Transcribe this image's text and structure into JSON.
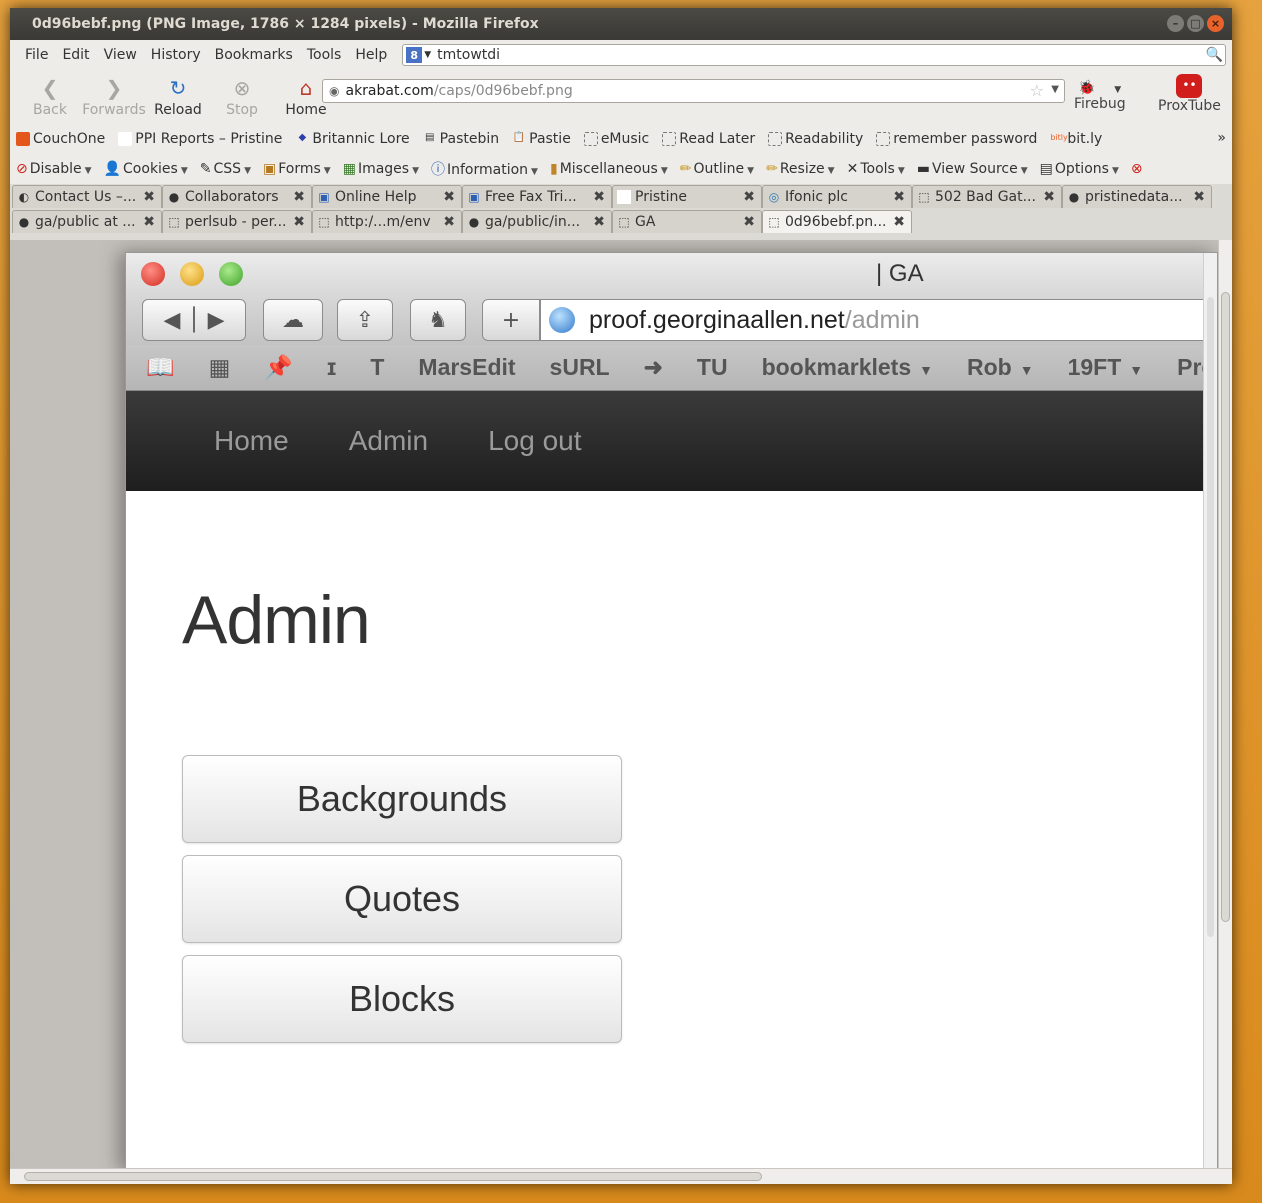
{
  "window": {
    "title": "0d96bebf.png (PNG Image, 1786 × 1284 pixels) - Mozilla Firefox"
  },
  "menu": [
    "File",
    "Edit",
    "View",
    "History",
    "Bookmarks",
    "Tools",
    "Help"
  ],
  "search": {
    "value": "tmtowtdi"
  },
  "nav": {
    "back": "Back",
    "forwards": "Forwards",
    "reload": "Reload",
    "stop": "Stop",
    "home": "Home",
    "url_host": "akrabat.com",
    "url_path": "/caps/0d96bebf.png",
    "firebug": "Firebug",
    "proxtube": "ProxTube"
  },
  "bookmarks": [
    "CouchOne",
    "PPI Reports – Pristine",
    "Britannic Lore",
    "Pastebin",
    "Pastie",
    "eMusic",
    "Read Later",
    "Readability",
    "remember password",
    "bit.ly"
  ],
  "devtools": [
    "Disable",
    "Cookies",
    "CSS",
    "Forms",
    "Images",
    "Information",
    "Miscellaneous",
    "Outline",
    "Resize",
    "Tools",
    "View Source",
    "Options"
  ],
  "tabs_row1": [
    "Contact Us –...",
    "Collaborators",
    "Online Help",
    "Free Fax Tri...",
    "Pristine",
    "Ifonic plc",
    "502 Bad Gat...",
    "pristinedata..."
  ],
  "tabs_row2": [
    "ga/public at ...",
    "perlsub - per...",
    "http:/...m/env",
    "ga/public/in...",
    "GA",
    "0d96bebf.pn..."
  ],
  "mac": {
    "title": "| GA",
    "url_host": "proof.georginaallen.net",
    "url_path": "/admin",
    "bookmarks": [
      "ɪ",
      "T",
      "MarsEdit",
      "sURL",
      "➜",
      "TU",
      "bookmarklets",
      "Rob",
      "19FT",
      "Pro"
    ]
  },
  "site": {
    "nav": [
      "Home",
      "Admin",
      "Log out"
    ],
    "heading": "Admin",
    "buttons": [
      "Backgrounds",
      "Quotes",
      "Blocks"
    ]
  }
}
